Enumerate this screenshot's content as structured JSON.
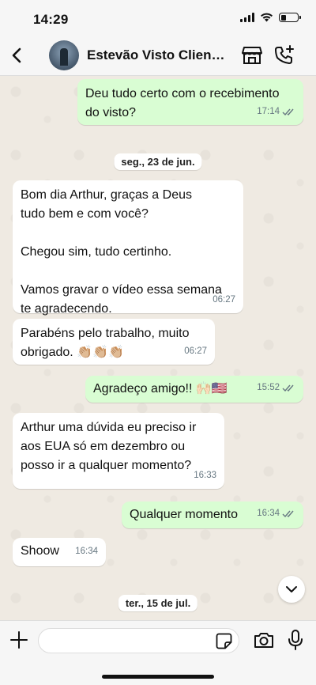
{
  "status_bar": {
    "time": "14:29"
  },
  "header": {
    "contact_name": "Estevão Visto Cliente..."
  },
  "messages": [
    {
      "direction": "out",
      "text": "Deu tudo certo com o recebimento\ndo visto?",
      "time": "17:14",
      "read": true
    },
    {
      "direction": "in",
      "text": "Bom dia Arthur, graças a Deus\ntudo bem e com você?\n\nChegou sim, tudo certinho.\n\nVamos gravar o vídeo essa semana\nte agradecendo.",
      "time": "06:27"
    },
    {
      "direction": "in",
      "text": "Parabéns pelo trabalho, muito\nobrigado. 👏🏼👏🏼👏🏼",
      "time": "06:27"
    },
    {
      "direction": "out",
      "text": "Agradeço amigo!! 🙌🏻🇺🇸",
      "time": "15:52",
      "read": true
    },
    {
      "direction": "in",
      "text": "Arthur uma dúvida eu preciso ir\naos EUA só em dezembro ou\nposso ir a qualquer momento?",
      "time": "16:33"
    },
    {
      "direction": "out",
      "text": "Qualquer momento",
      "time": "16:34",
      "read": true
    },
    {
      "direction": "in",
      "text": "Shoow",
      "time": "16:34"
    }
  ],
  "date_separators": [
    "seg., 23 de jun.",
    "ter., 15 de jul."
  ],
  "composer": {
    "placeholder": ""
  },
  "colors": {
    "outgoing_bubble": "#d9fdd3",
    "incoming_bubble": "#ffffff",
    "chat_background": "#efeae2",
    "read_ticks": "#53bdeb"
  }
}
